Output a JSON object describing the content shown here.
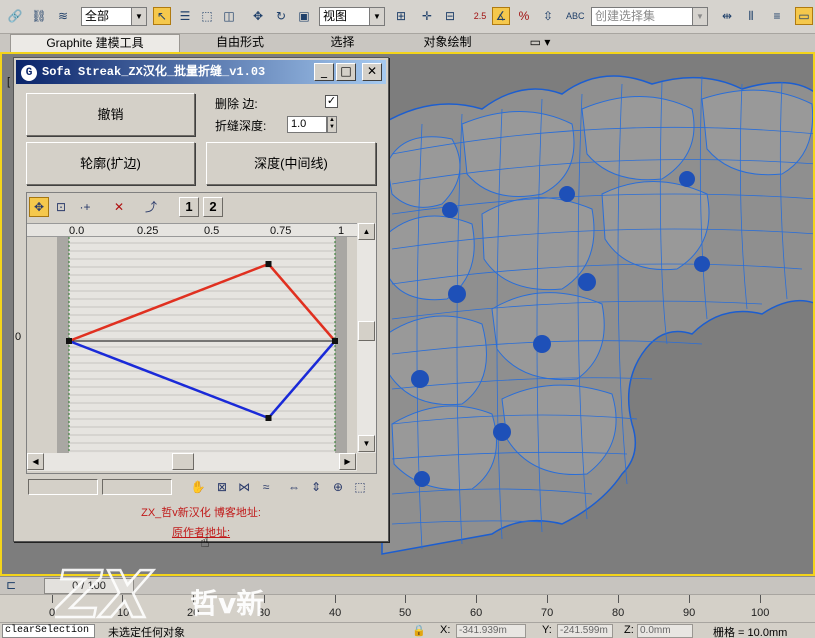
{
  "toolbar": {
    "selection_filter": "全部",
    "coord_system": "视图",
    "named_selection_placeholder": "创建选择集",
    "icons": [
      "link-icon",
      "unlink-icon",
      "bind-space-warp-icon",
      "select-object-icon",
      "select-by-name-icon",
      "rect-region-icon",
      "window-crossing-icon",
      "move-icon",
      "rotate-icon",
      "scale-icon",
      "pivot-icon",
      "keyboard-shortcut-icon",
      "snap-toggle-icon",
      "angle-snap-icon",
      "percent-snap-icon",
      "spinner-snap-icon",
      "edit-named-selection-icon",
      "mirror-icon",
      "align-icon"
    ]
  },
  "ribbon": {
    "tabs": [
      {
        "label": "Graphite 建模工具",
        "active": true
      },
      {
        "label": "自由形式",
        "active": false
      },
      {
        "label": "选择",
        "active": false
      },
      {
        "label": "对象绘制",
        "active": false
      }
    ]
  },
  "viewport": {
    "label": "[",
    "border_color": "#f3d41b",
    "mesh_color": "#2a6ed8"
  },
  "dialog": {
    "title": "Sofa Streak_ZX汉化_批量折缝_v1.03",
    "undo_label": "撤销",
    "delete_edge_label": "删除  边:",
    "delete_edge_checked": "✓",
    "crease_depth_label": "折缝深度:",
    "crease_depth_value": "1.0",
    "outline_label": "轮廓(扩边)",
    "depth_label": "深度(中间线)",
    "curve_tool_1": "1",
    "curve_tool_2": "2",
    "ruler_ticks": [
      "0.0",
      "0.25",
      "0.5",
      "0.75",
      "1"
    ],
    "zero_label": "0",
    "zh_blog_label": "ZX_哲v新汉化 博客地址:",
    "author_label": "原作者地址:",
    "curves": {
      "top": {
        "color": "#e03020",
        "points": [
          [
            0.0,
            0.0
          ],
          [
            0.75,
            0.5
          ],
          [
            1.0,
            0.0
          ]
        ]
      },
      "bottom": {
        "color": "#1a2ad8",
        "points": [
          [
            0.0,
            0.0
          ],
          [
            0.75,
            -0.5
          ],
          [
            1.0,
            0.0
          ]
        ]
      }
    }
  },
  "timeline": {
    "slider_label": "0 / 100",
    "ruler_numbers": [
      "0",
      "10",
      "20",
      "30",
      "40",
      "50",
      "60",
      "70",
      "80",
      "90",
      "100"
    ]
  },
  "status": {
    "maxscript": "clearSelection",
    "prompt": "未选定任何对象",
    "x_label": "X:",
    "x_value": "-341.939m",
    "y_label": "Y:",
    "y_value": "-241.599m",
    "z_label": "Z:",
    "z_value": "0.0mm",
    "grid_label": "栅格 = 10.0mm"
  },
  "watermark": {
    "logo_text": "ZX",
    "sub_text": "哲v新"
  }
}
